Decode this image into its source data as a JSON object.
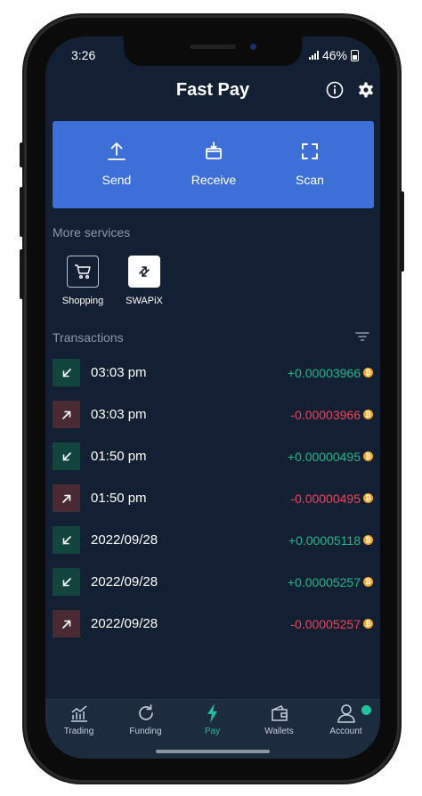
{
  "status": {
    "time": "3:26",
    "battery": "46%"
  },
  "header": {
    "title": "Fast Pay",
    "info_icon": "info-icon",
    "settings_icon": "gear-icon"
  },
  "actions": [
    {
      "label": "Send",
      "icon": "upload-icon"
    },
    {
      "label": "Receive",
      "icon": "receive-icon"
    },
    {
      "label": "Scan",
      "icon": "scan-icon"
    }
  ],
  "more_services": {
    "label": "More services",
    "items": [
      {
        "label": "Shopping",
        "icon": "cart-icon"
      },
      {
        "label": "SWAPiX",
        "icon": "swap-icon"
      }
    ]
  },
  "transactions": {
    "label": "Transactions",
    "filter_icon": "filter-icon",
    "coin_icon": "bitcoin-icon",
    "items": [
      {
        "direction": "in",
        "time": "03:03 pm",
        "amount": "+0.00003966"
      },
      {
        "direction": "out",
        "time": "03:03 pm",
        "amount": "-0.00003966"
      },
      {
        "direction": "in",
        "time": "01:50 pm",
        "amount": "+0.00000495"
      },
      {
        "direction": "out",
        "time": "01:50 pm",
        "amount": "-0.00000495"
      },
      {
        "direction": "in",
        "time": "2022/09/28",
        "amount": "+0.00005118"
      },
      {
        "direction": "in",
        "time": "2022/09/28",
        "amount": "+0.00005257"
      },
      {
        "direction": "out",
        "time": "2022/09/28",
        "amount": "-0.00005257"
      }
    ]
  },
  "nav": [
    {
      "label": "Trading",
      "icon": "chart-icon"
    },
    {
      "label": "Funding",
      "icon": "refresh-icon"
    },
    {
      "label": "Pay",
      "icon": "bolt-icon",
      "active": true
    },
    {
      "label": "Wallets",
      "icon": "wallet-icon"
    },
    {
      "label": "Account",
      "icon": "user-icon"
    }
  ],
  "colors": {
    "background": "#132033",
    "accent": "#3e6fd8",
    "positive": "#1fb88a",
    "negative": "#f0405a",
    "active_nav": "#1fc29a"
  }
}
